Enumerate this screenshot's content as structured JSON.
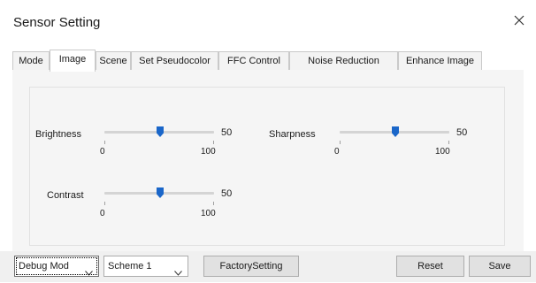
{
  "window": {
    "title": "Sensor Setting",
    "close_icon": "close-icon"
  },
  "tabs": [
    {
      "label": "Mode"
    },
    {
      "label": "Image"
    },
    {
      "label": "Scene"
    },
    {
      "label": "Set Pseudocolor"
    },
    {
      "label": "FFC Control"
    },
    {
      "label": "Noise Reduction"
    },
    {
      "label": "Enhance Image"
    }
  ],
  "active_tab": "Image",
  "sliders": {
    "brightness": {
      "label": "Brightness",
      "value": "50",
      "min": "0",
      "max": "100"
    },
    "sharpness": {
      "label": "Sharpness",
      "value": "50",
      "min": "0",
      "max": "100"
    },
    "contrast": {
      "label": "Contrast",
      "value": "50",
      "min": "0",
      "max": "100"
    }
  },
  "footer": {
    "mode_select": "Debug Mod",
    "scheme_select": "Scheme 1",
    "factory_button": "FactorySetting",
    "reset_button": "Reset",
    "save_button": "Save"
  },
  "colors": {
    "slider_thumb": "#1a66c9",
    "panel_bg": "#f5f5f5",
    "footer_bg": "#f0f0f0"
  }
}
